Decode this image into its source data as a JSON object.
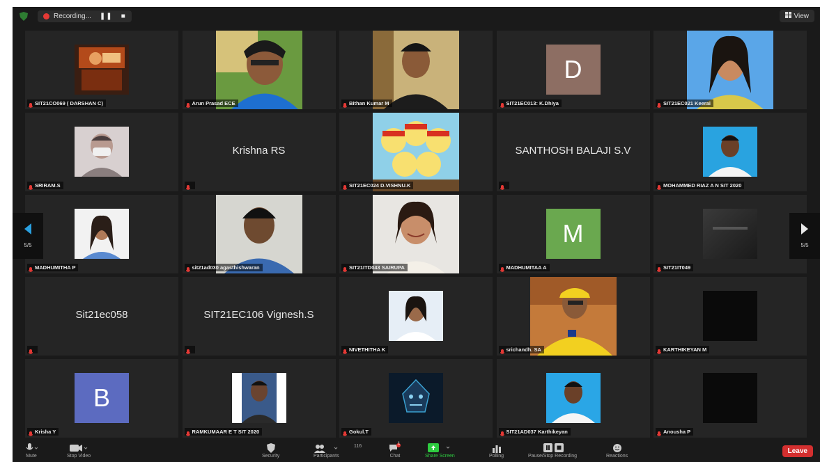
{
  "topbar": {
    "recording_label": "Recording...",
    "pause_symbol": "❚❚",
    "stop_symbol": "■",
    "view_label": "View"
  },
  "tiles": [
    {
      "name": "SIT21CO069 ( DARSHAN C)",
      "kind": "photo",
      "art": "poster"
    },
    {
      "name": "Arun Prasad ECE",
      "kind": "photo",
      "art": "selfie"
    },
    {
      "name": "Bithan Kumar M",
      "kind": "photo",
      "art": "man-tshirt"
    },
    {
      "name": "SIT21EC013: K.Dhiya",
      "kind": "initial",
      "initial": "D",
      "color": "#8d6e63"
    },
    {
      "name": "SIT21EC021 Keerai",
      "kind": "photo",
      "art": "woman-blue"
    },
    {
      "name": "SRIRAM.S",
      "kind": "photo",
      "art": "masked"
    },
    {
      "name": "",
      "kind": "text",
      "center": "Krishna RS"
    },
    {
      "name": "SIT21EC024 D.VISHNU.K",
      "kind": "photo",
      "art": "cartoon"
    },
    {
      "name": "",
      "kind": "text",
      "center": "SANTHOSH BALAJI S.V"
    },
    {
      "name": "MOHAMMED RIAZ A N SIT 2020",
      "kind": "photo",
      "art": "passport-man"
    },
    {
      "name": "MADHUMITHA P",
      "kind": "photo",
      "art": "woman-small"
    },
    {
      "name": "sit21ad030 agasthishwaran",
      "kind": "photo",
      "art": "passport-man2"
    },
    {
      "name": "SIT21ITD043 SAIRUPA",
      "kind": "photo",
      "art": "woman-smile"
    },
    {
      "name": "MADHUMITAA A",
      "kind": "initial",
      "initial": "M",
      "color": "#6aa84f"
    },
    {
      "name": "SIT21IT049",
      "kind": "photo",
      "art": "dark"
    },
    {
      "name": "",
      "kind": "text",
      "center": "Sit21ec058"
    },
    {
      "name": "",
      "kind": "text",
      "center": "SIT21EC106 Vignesh.S"
    },
    {
      "name": "NIVETHITHA K",
      "kind": "photo",
      "art": "woman-passport"
    },
    {
      "name": "srichandh. SA",
      "kind": "photo",
      "art": "cricketer"
    },
    {
      "name": "KARTHIKEYAN M",
      "kind": "photo",
      "art": "black"
    },
    {
      "name": "Krisha Y",
      "kind": "initial",
      "initial": "B",
      "color": "#5c6bc0"
    },
    {
      "name": "RAMKUMAAR E T SIT 2020",
      "kind": "photo",
      "art": "boy-white"
    },
    {
      "name": "Gokul.T",
      "kind": "photo",
      "art": "logo"
    },
    {
      "name": "SIT21AD037 Karthikeyan",
      "kind": "photo",
      "art": "boy-blue"
    },
    {
      "name": "Anousha P",
      "kind": "photo",
      "art": "black"
    }
  ],
  "paging": {
    "left": "5/5",
    "right": "5/5"
  },
  "toolbar": {
    "mute": "Mute",
    "stop_video": "Stop Video",
    "security": "Security",
    "participants": "Participants",
    "participants_count": "116",
    "chat": "Chat",
    "chat_badge": "1",
    "share_screen": "Share Screen",
    "polling": "Polling",
    "pause_recording": "Pause/Stop Recording",
    "reactions": "Reactions",
    "leave": "Leave"
  }
}
